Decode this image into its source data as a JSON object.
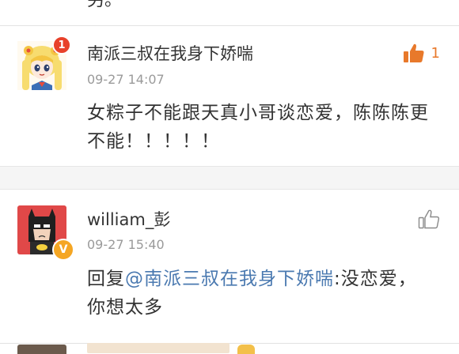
{
  "top_fragment": "另。",
  "comments": [
    {
      "username": "南派三叔在我身下娇喘",
      "timestamp": "09-27 14:07",
      "text": "女粽子不能跟天真小哥谈恋爱，陈陈陈更不能！！！！！",
      "likes": "1",
      "liked": true,
      "notification_badge": "1",
      "avatar_icon": "anime-girl-avatar-icon"
    },
    {
      "username": "william_彭",
      "timestamp": "09-27 15:40",
      "reply_prefix": "回复",
      "mention": "@南派三叔在我身下娇喘",
      "text": ":没恋爱，你想太多",
      "likes": "",
      "liked": false,
      "verified_badge": "V",
      "avatar_icon": "batman-avatar-icon"
    }
  ],
  "colors": {
    "accent_orange": "#e8792b",
    "mention_blue": "#4a79b0",
    "timestamp_gray": "#9a9a9a",
    "notify_red": "#e8412a",
    "verified_gold": "#f5a623"
  }
}
